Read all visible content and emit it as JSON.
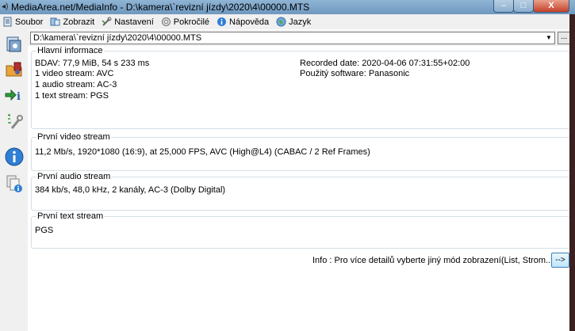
{
  "window": {
    "title": "MediaArea.net/MediaInfo - D:\\kamera\\`revizní jízdy\\2020\\4\\00000.MTS",
    "app_icon": "speaker-icon",
    "minimize": "–",
    "maximize": "□",
    "close": "X"
  },
  "menu": [
    {
      "label": "Soubor",
      "icon": "file-icon"
    },
    {
      "label": "Zobrazit",
      "icon": "view-icon"
    },
    {
      "label": "Nastavení",
      "icon": "settings-icon"
    },
    {
      "label": "Pokročilé",
      "icon": "advanced-icon"
    },
    {
      "label": "Nápověda",
      "icon": "help-icon"
    },
    {
      "label": "Jazyk",
      "icon": "language-icon"
    }
  ],
  "toolbar": [
    {
      "name": "open-file",
      "icon": "open-file-icon"
    },
    {
      "name": "open-folder",
      "icon": "open-folder-icon"
    },
    {
      "name": "export",
      "icon": "export-icon"
    },
    {
      "name": "preferences",
      "icon": "wrench-icon"
    },
    {
      "name": "about",
      "icon": "info-icon"
    },
    {
      "name": "knowledge",
      "icon": "knowledge-icon"
    }
  ],
  "path": {
    "value": "D:\\kamera\\`revizní jízdy\\2020\\4\\00000.MTS",
    "dropdown": "▼",
    "browse": "..."
  },
  "general": {
    "title": "Hlavní informace",
    "line1": "BDAV: 77,9 MiB, 54 s 233 ms",
    "line2": "1 video stream: AVC",
    "line3": "1 audio stream: AC-3",
    "line4": "1 text stream: PGS",
    "recorded_date": "Recorded date: 2020-04-06 07:31:55+02:00",
    "software": "Použitý software: Panasonic"
  },
  "video": {
    "title": "První video stream",
    "line1": "11,2 Mb/s, 1920*1080 (16:9), at 25,000 FPS, AVC (High@L4) (CABAC / 2 Ref Frames)"
  },
  "audio": {
    "title": "První audio stream",
    "line1": "384 kb/s, 48,0 kHz, 2 kanály, AC-3 (Dolby Digital)"
  },
  "text": {
    "title": "První text stream",
    "line1": "PGS"
  },
  "footer": {
    "info": "Info : Pro více detailů vyberte jiný mód zobrazení(List, Strom...)",
    "next_button": "-->"
  }
}
